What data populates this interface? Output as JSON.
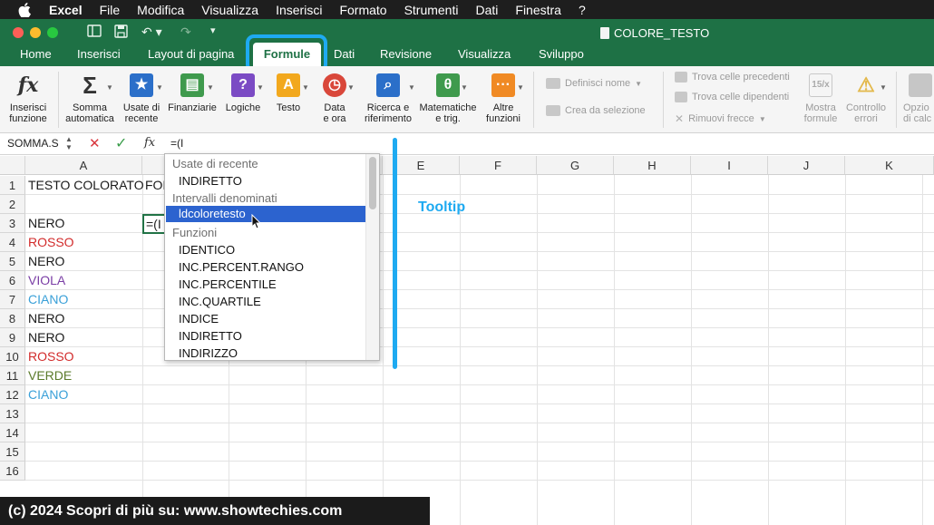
{
  "menubar": {
    "app": "Excel",
    "items": [
      "File",
      "Modifica",
      "Visualizza",
      "Inserisci",
      "Formato",
      "Strumenti",
      "Dati",
      "Finestra",
      "?"
    ]
  },
  "window": {
    "title": "COLORE_TESTO"
  },
  "ribbon_tabs": [
    "Home",
    "Inserisci",
    "Layout di pagina",
    "Formule",
    "Dati",
    "Revisione",
    "Visualizza",
    "Sviluppo"
  ],
  "active_tab": "Formule",
  "ribbon": {
    "insert_function": "Inserisci\nfunzione",
    "autosum": "Somma\nautomatica",
    "recent": "Usate di\nrecente",
    "financial": "Finanziarie",
    "logical": "Logiche",
    "text": "Testo",
    "date_time": "Data\ne ora",
    "lookup": "Ricerca e\nriferimento",
    "math": "Matematiche\ne trig.",
    "more": "Altre\nfunzioni",
    "define_name": "Definisci nome",
    "create_from_selection": "Crea da selezione",
    "trace_precedents": "Trova celle precedenti",
    "trace_dependents": "Trova celle dipendenti",
    "remove_arrows": "Rimuovi frecce",
    "show_formulas": "Mostra\nformule",
    "error_checking": "Controllo\nerrori",
    "calc_options": "Opzio\ndi calc"
  },
  "formula_bar": {
    "name_box": "SOMMA.S",
    "content": "=(I"
  },
  "columns": [
    "A",
    "B",
    "C",
    "D",
    "E",
    "F",
    "G",
    "H",
    "I",
    "J",
    "K"
  ],
  "rows": [
    "1",
    "2",
    "3",
    "4",
    "5",
    "6",
    "7",
    "8",
    "9",
    "10",
    "11",
    "12",
    "13",
    "14",
    "15",
    "16"
  ],
  "cells": {
    "A1": "TESTO COLORATO",
    "B1": "FOR",
    "A3": "NERO",
    "A4": "ROSSO",
    "A5": "NERO",
    "A6": "VIOLA",
    "A7": "CIANO",
    "A8": "NERO",
    "A9": "NERO",
    "A10": "ROSSO",
    "A11": "VERDE",
    "A12": "CIANO"
  },
  "colors": {
    "black": "#1a1a1a",
    "red": "#d22b2b",
    "purple": "#7a3da5",
    "cyan": "#3aa0d8",
    "green": "#5a7a2a",
    "excel_green": "#1e7145",
    "annotation": "#1eaaf1",
    "selection": "#2c63cf"
  },
  "active_cell": {
    "ref": "B3",
    "value": "=(I"
  },
  "autocomplete": {
    "group_recent": "Usate di recente",
    "recent_items": [
      "INDIRETTO"
    ],
    "group_named": "Intervalli denominati",
    "selected": "ldcoloretesto",
    "group_functions": "Funzioni",
    "functions": [
      "IDENTICO",
      "INC.PERCENT.RANGO",
      "INC.PERCENTILE",
      "INC.QUARTILE",
      "INDICE",
      "INDIRETTO",
      "INDIRIZZO"
    ]
  },
  "annotation_label": "Tooltip",
  "footer": "(c) 2024 Scopri di più su: www.showtechies.com"
}
